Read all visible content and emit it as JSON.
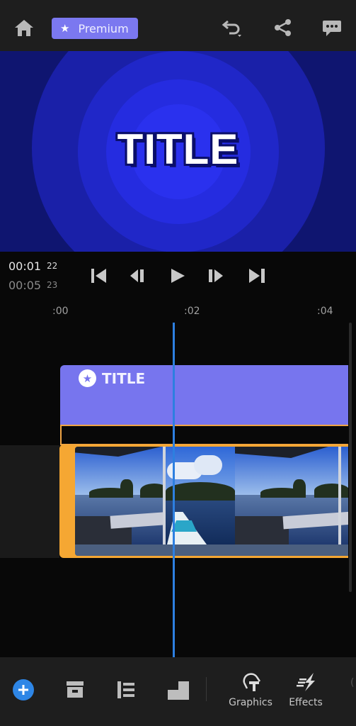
{
  "top_bar": {
    "home_icon": "home-icon",
    "premium_label": "Premium",
    "undo_icon": "undo-icon",
    "share_icon": "share-icon",
    "feedback_icon": "feedback-icon"
  },
  "preview": {
    "title_text": "TITLE",
    "colors": {
      "background": "#0f1570",
      "ring_outer": "#1a20a8",
      "ring_mid": "#2228d0",
      "ring_inner": "#2b31f0"
    }
  },
  "timecode": {
    "current": "00:01",
    "current_frames": "22",
    "total": "00:05",
    "total_frames": "23"
  },
  "transport": {
    "buttons": [
      "go-to-start",
      "previous-frame",
      "play",
      "next-frame",
      "go-to-end"
    ]
  },
  "ruler": {
    "ticks": [
      ":00",
      ":02",
      ":04"
    ]
  },
  "timeline": {
    "title_clip": {
      "label": "TITLE",
      "color": "#7775ee"
    },
    "video_clip": {
      "handle_color": "#f5a733"
    },
    "playhead_color": "#2d7fe0"
  },
  "toolbar": {
    "items": [
      {
        "name": "add",
        "label": ""
      },
      {
        "name": "media",
        "label": ""
      },
      {
        "name": "align",
        "label": ""
      },
      {
        "name": "crop",
        "label": ""
      },
      {
        "name": "graphics",
        "label": "Graphics"
      },
      {
        "name": "effects",
        "label": "Effects"
      }
    ]
  }
}
